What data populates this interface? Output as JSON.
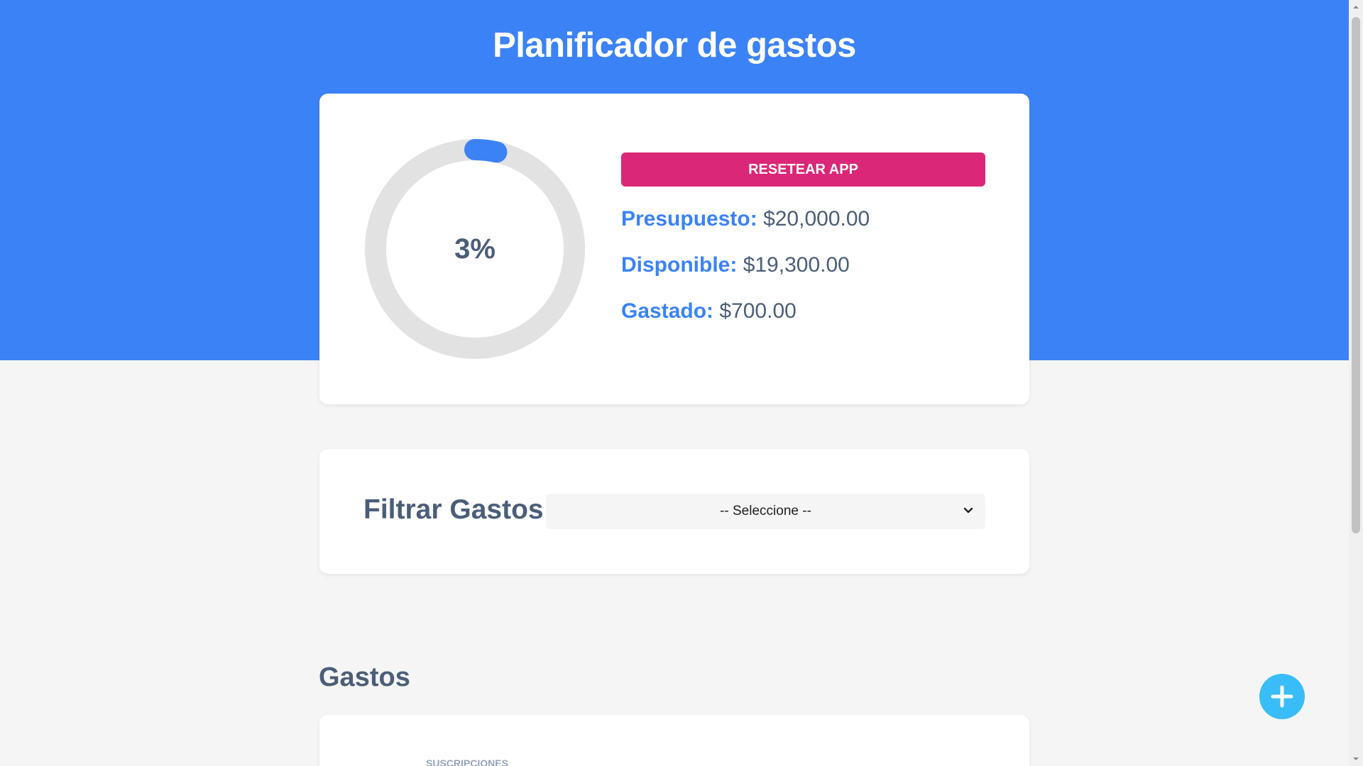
{
  "header": {
    "title": "Planificador de gastos"
  },
  "budget": {
    "percent_label": "3%",
    "percent_value": 3.5,
    "reset_label": "Resetear App",
    "stats": [
      {
        "label": "Presupuesto:",
        "value": "$20,000.00"
      },
      {
        "label": "Disponible:",
        "value": "$19,300.00"
      },
      {
        "label": "Gastado:",
        "value": "$700.00"
      }
    ]
  },
  "filter": {
    "label": "Filtrar Gastos",
    "selected": "-- Seleccione --"
  },
  "expenses": {
    "title": "Gastos",
    "items": [
      {
        "category": "Suscripciones"
      }
    ]
  },
  "fab": {
    "icon": "plus-icon"
  },
  "colors": {
    "accent": "#3b82f6",
    "danger": "#db2777",
    "fab": "#38bdf8",
    "text": "#4b5e78"
  }
}
